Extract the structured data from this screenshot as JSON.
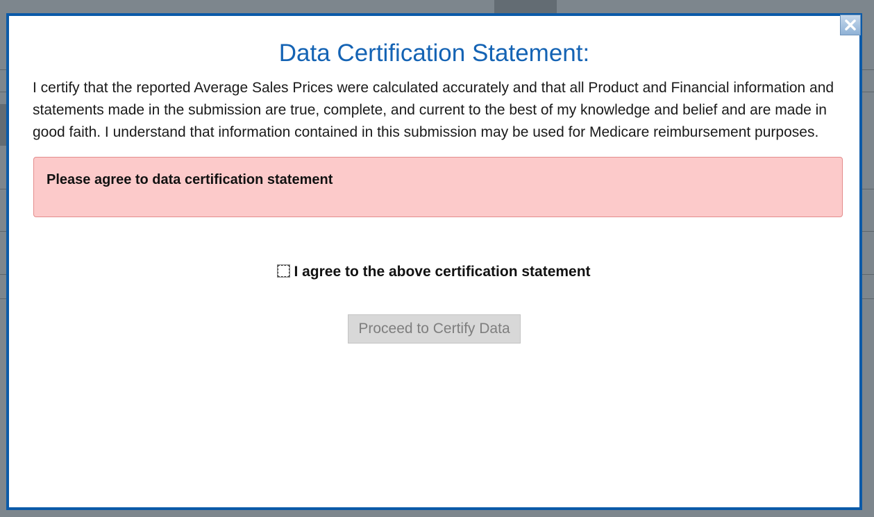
{
  "modal": {
    "title": "Data Certification Statement:",
    "statement": "I certify that the reported Average Sales Prices were calculated accurately and that all Product and Financial information and statements made in the submission are true, complete, and current to the best of my knowledge and belief and are made in good faith. I understand that information contained in this submission may be used for Medicare reimbursement purposes.",
    "alert": "Please agree to data certification statement",
    "agree_label": "I agree to the above certification statement",
    "agree_checked": false,
    "proceed_button": "Proceed to Certify Data",
    "proceed_disabled": true,
    "close_icon": "close-icon"
  },
  "colors": {
    "title": "#1463b4",
    "border": "#0b5aa8",
    "alert_bg": "#fccaca",
    "alert_border": "#e38c8c"
  }
}
